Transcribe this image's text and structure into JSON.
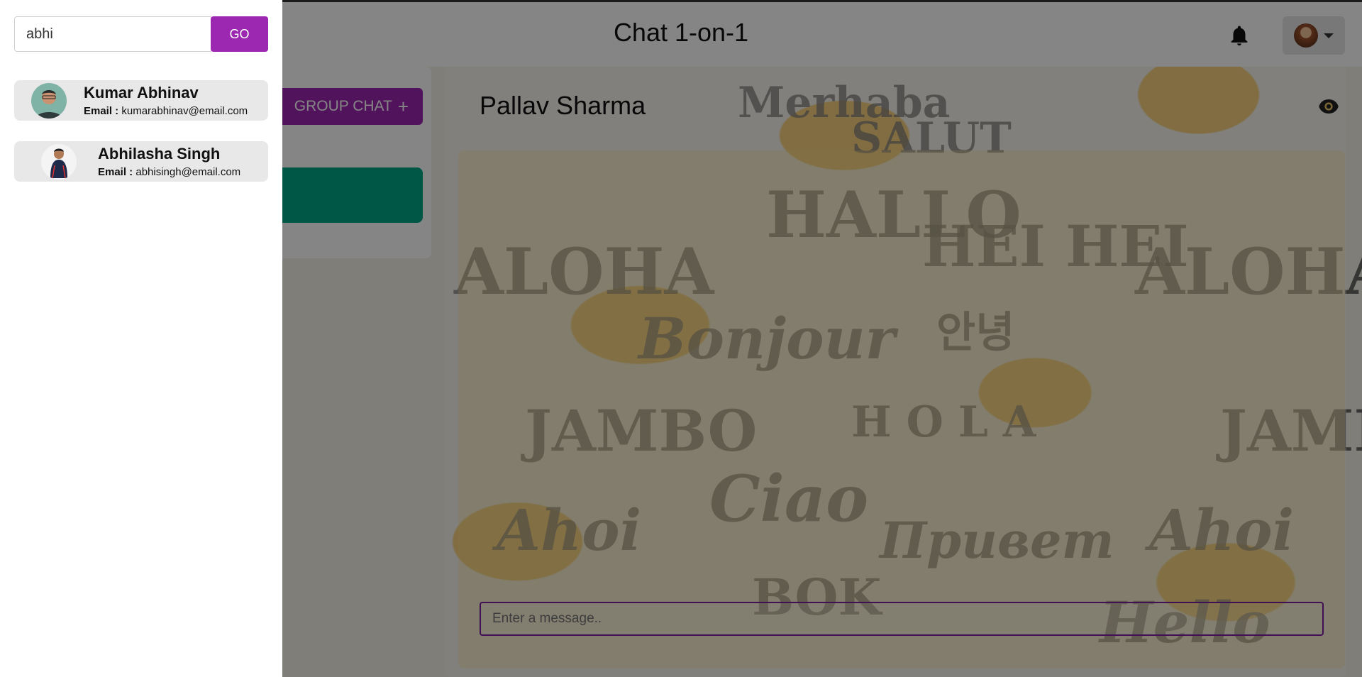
{
  "app": {
    "title": "Chat 1-on-1"
  },
  "header": {
    "bell_icon": "bell-icon",
    "profile_icon": "avatar",
    "caret_icon": "chevron-down-icon"
  },
  "sidebar": {
    "group_chat_label": "GROUP CHAT"
  },
  "chat": {
    "contact_name": "Pallav Sharma",
    "message_placeholder": "Enter a message..",
    "view_icon": "eye-icon"
  },
  "drawer": {
    "search_value": "abhi",
    "go_label": "GO",
    "results": [
      {
        "name": "Kumar Abhinav",
        "email_label": "Email : ",
        "email": "kumarabhinav@email.com"
      },
      {
        "name": "Abhilasha Singh",
        "email_label": "Email : ",
        "email": "abhisingh@email.com"
      }
    ]
  },
  "colors": {
    "accent": "#9c27b0",
    "chat_item": "#00a887",
    "input_border": "#7b1fa2"
  }
}
